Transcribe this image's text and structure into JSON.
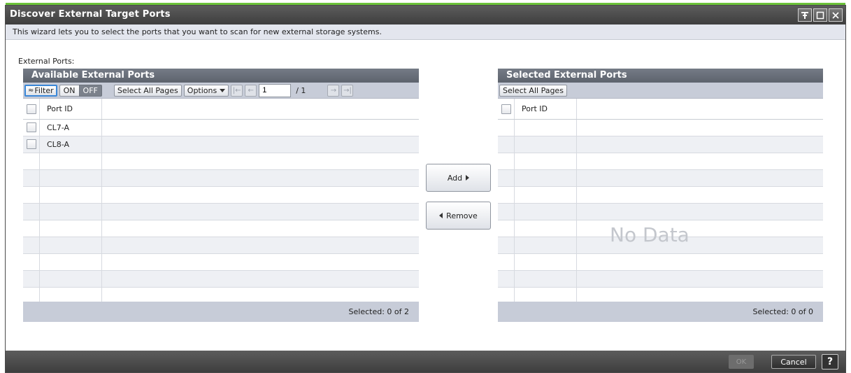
{
  "window": {
    "title": "Discover External Target Ports",
    "description": "This wizard lets you to select the ports that you want to scan for new external storage systems.",
    "section_label": "External Ports:"
  },
  "left_panel": {
    "title": "Available External Ports",
    "toolbar": {
      "filter_label": "Filter",
      "on_label": "ON",
      "off_label": "OFF",
      "select_all_label": "Select All Pages",
      "options_label": "Options",
      "page_value": "1",
      "page_total": "/ 1"
    },
    "column_header": "Port ID",
    "rows": [
      "CL7-A",
      "CL8-A",
      "",
      "",
      "",
      "",
      "",
      "",
      "",
      "",
      "",
      ""
    ],
    "footer": "Selected:  0   of  2"
  },
  "right_panel": {
    "title": "Selected External Ports",
    "toolbar": {
      "select_all_label": "Select All Pages"
    },
    "column_header": "Port ID",
    "empty_text": "No Data",
    "footer": "Selected:  0   of  0"
  },
  "middle": {
    "add_label": "Add",
    "remove_label": "Remove"
  },
  "bottom": {
    "ok_label": "OK",
    "cancel_label": "Cancel",
    "help_label": "?"
  },
  "colors": {
    "accent_green": "#6cc23a",
    "filter_focus": "#3a87d8"
  }
}
